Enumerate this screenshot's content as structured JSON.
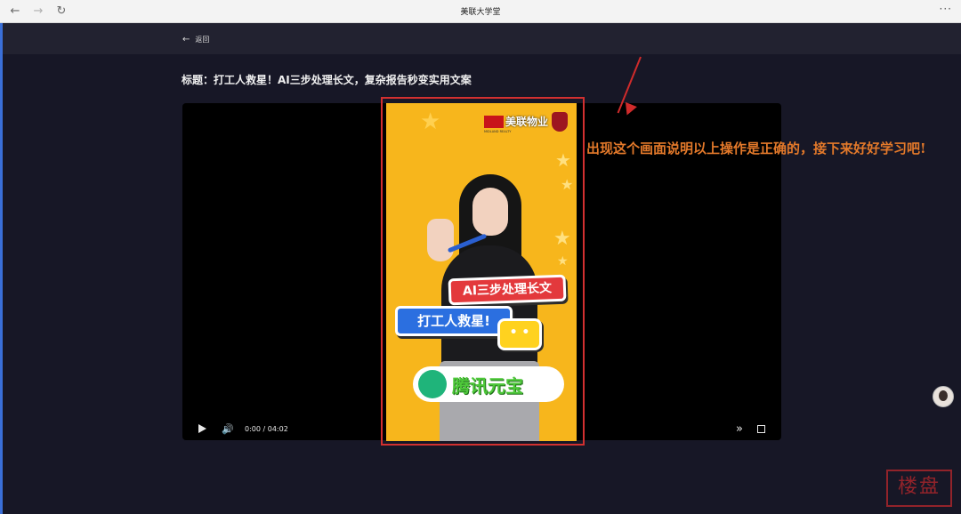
{
  "browser": {
    "title": "美联大学堂",
    "back_icon": "←",
    "forward_icon": "→",
    "reload_icon": "↻",
    "more_icon": "···"
  },
  "header": {
    "back_label": "返回"
  },
  "page": {
    "title": "标题：打工人救星！AI三步处理长文，复杂报告秒变实用文案"
  },
  "player": {
    "time": "0:00 / 04:02",
    "volume_icon": "🔊",
    "speed_icon": "»"
  },
  "frame": {
    "logo_text": "美联物业",
    "logo_sub": "MIDLAND REALTY",
    "banner_red": "AI三步处理长文",
    "banner_blue": "打工人救星!",
    "bubble": "• •",
    "brand": "腾讯元宝"
  },
  "annotation": {
    "text": "出现这个画面说明以上操作是正确的，接下来好好学习吧!"
  },
  "watermark": {
    "text": "楼盘"
  }
}
